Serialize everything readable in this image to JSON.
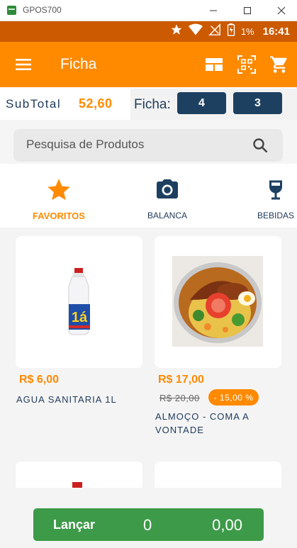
{
  "window": {
    "title": "GPOS700"
  },
  "status_bar": {
    "battery_percent": "1%",
    "time": "16:41"
  },
  "app_bar": {
    "title": "Ficha"
  },
  "summary": {
    "subtotal_label": "SubTotal",
    "subtotal_value": "52,60",
    "ficha_label": "Ficha:",
    "ficha_buttons": [
      "4",
      "3"
    ]
  },
  "search": {
    "placeholder": "Pesquisa de Produtos"
  },
  "categories": [
    {
      "label": "FAVORITOS",
      "icon": "star-icon",
      "active": true
    },
    {
      "label": "BALANCA",
      "icon": "camera-icon",
      "active": false
    },
    {
      "label": "BEBIDAS",
      "icon": "wine-glass-icon",
      "active": false
    }
  ],
  "products": [
    {
      "price": "R$ 6,00",
      "name": "AGUA SANITARIA 1L",
      "image": "bleach-bottle"
    },
    {
      "price": "R$ 17,00",
      "old_price": "R$ 20,00",
      "discount": "- 15,00 %",
      "name": "ALMOÇO - COMA A VONTADE",
      "image": "food-plate"
    }
  ],
  "bottom_bar": {
    "button_label": "Lançar",
    "quantity": "0",
    "total": "0,00"
  },
  "colors": {
    "accent": "#ff8a00",
    "status_bar": "#cc5a00",
    "navy": "#1d4060",
    "green": "#3c9a48"
  }
}
